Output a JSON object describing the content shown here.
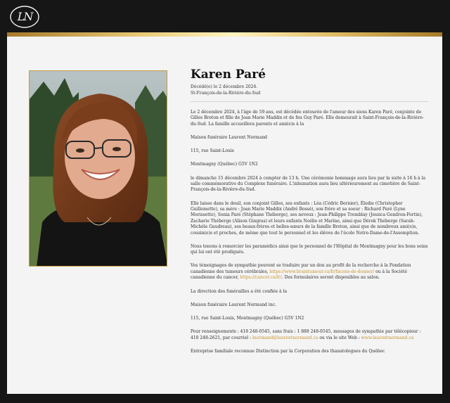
{
  "logo": {
    "text": "LN",
    "icon": "ln-monogram-icon"
  },
  "colors": {
    "gold": "#c69a3e",
    "link": "#c7922b",
    "background": "#161616",
    "card": "#f4f4f4"
  },
  "obituary": {
    "name": "Karen Paré",
    "deceased": "Décédé(e) le 2 décembre 2024.",
    "location": "St-François-de-la-Rivière-du-Sud"
  },
  "paragraphs": {
    "p1": "Le 2 décembre 2024, à l'âge de 59 ans, est décédée entourée de l'amour des siens Karen Paré, conjointe de Gilles Breton et fille de Joan Marie Maddix et de feu Guy Paré. Elle demeurait à Saint-François-de-la-Rivière-du-Sud. La famille accueillera parents et ami(e)s à la",
    "p2": "Maison funéraire Laurent Normand",
    "p3": "115, rue Saint-Louis",
    "p4": "Montmagny (Québec) G5V 1N2",
    "p5": "le dimanche 15 décembre 2024 à compter de 13 h. Une cérémonie hommage aura lieu par la suite à 16 h à la salle commémorative du Complexe funéraire. L'inhumation aura lieu ultérieurement au cimetière de Saint-François-de-la-Rivière-du-Sud.",
    "p6": "Elle laisse dans le deuil, son conjoint Gilles, ses enfants : Léa (Cédric Bernier), Élodie (Christopher Guillemette), sa mère : Joan Marie Maddix (André Bossé), son frère et sa soeur : Richard Paré (Lyne Morissette), Sonia Paré (Stéphane Théberge), ses neveux : Jean-Philippe Tremblay (Jessica Gendron-Fortin), Zacharie Théberge (Alison Gingras) et leurs enfants Noélie et Marine, ainsi que Dérek Théberge (Sarah-Michèle Gaudreau), ses beaux-frères et belles-sœurs de la famille Breton, ainsi que de nombreux ami(e)s, cousin(e)s et proches, de même que tout le personnel et les élèves de l'école Notre-Dame-de-l'Assomption.",
    "p7": "Nous tenons à remercier les paramédics ainsi que le personnel de l'Hôpital de Montmagny pour les bons soins qui lui ont été prodigués.",
    "p8_a": "Vos témoignages de sympathie peuvent se traduire par un don au profit de la recherche à la Fondation canadienne des tumeurs cérébrales,",
    "p8_link1": "https://www.braintumour.ca/fr/facons-de-donner/",
    "p8_b": "ou à la Société canadienne du cancer,",
    "p8_link2": "https://cancer.ca/fr/",
    "p8_c": ". Des formulaires seront disponibles au salon.",
    "p9": "La direction des funérailles a été confiée à la",
    "p10": "Maison funéraire Laurent Normand inc.",
    "p11": "115, rue Saint-Louis, Montmagny (Québec) G5V 1N2",
    "p12_a": "Pour renseignements : 418 248-0545, sans frais : 1 888 248-0545, messages de sympathie par télécopieur : 418 248-2621, par courriel :",
    "p12_link1": "lnormand@laurentnormand.ca",
    "p12_b": "ou via le site Web :",
    "p12_link2": "www.laurentnormand.ca",
    "p13": "Entreprise familiale reconnue Distinction par la Corporation des thanatologues du Québec"
  }
}
